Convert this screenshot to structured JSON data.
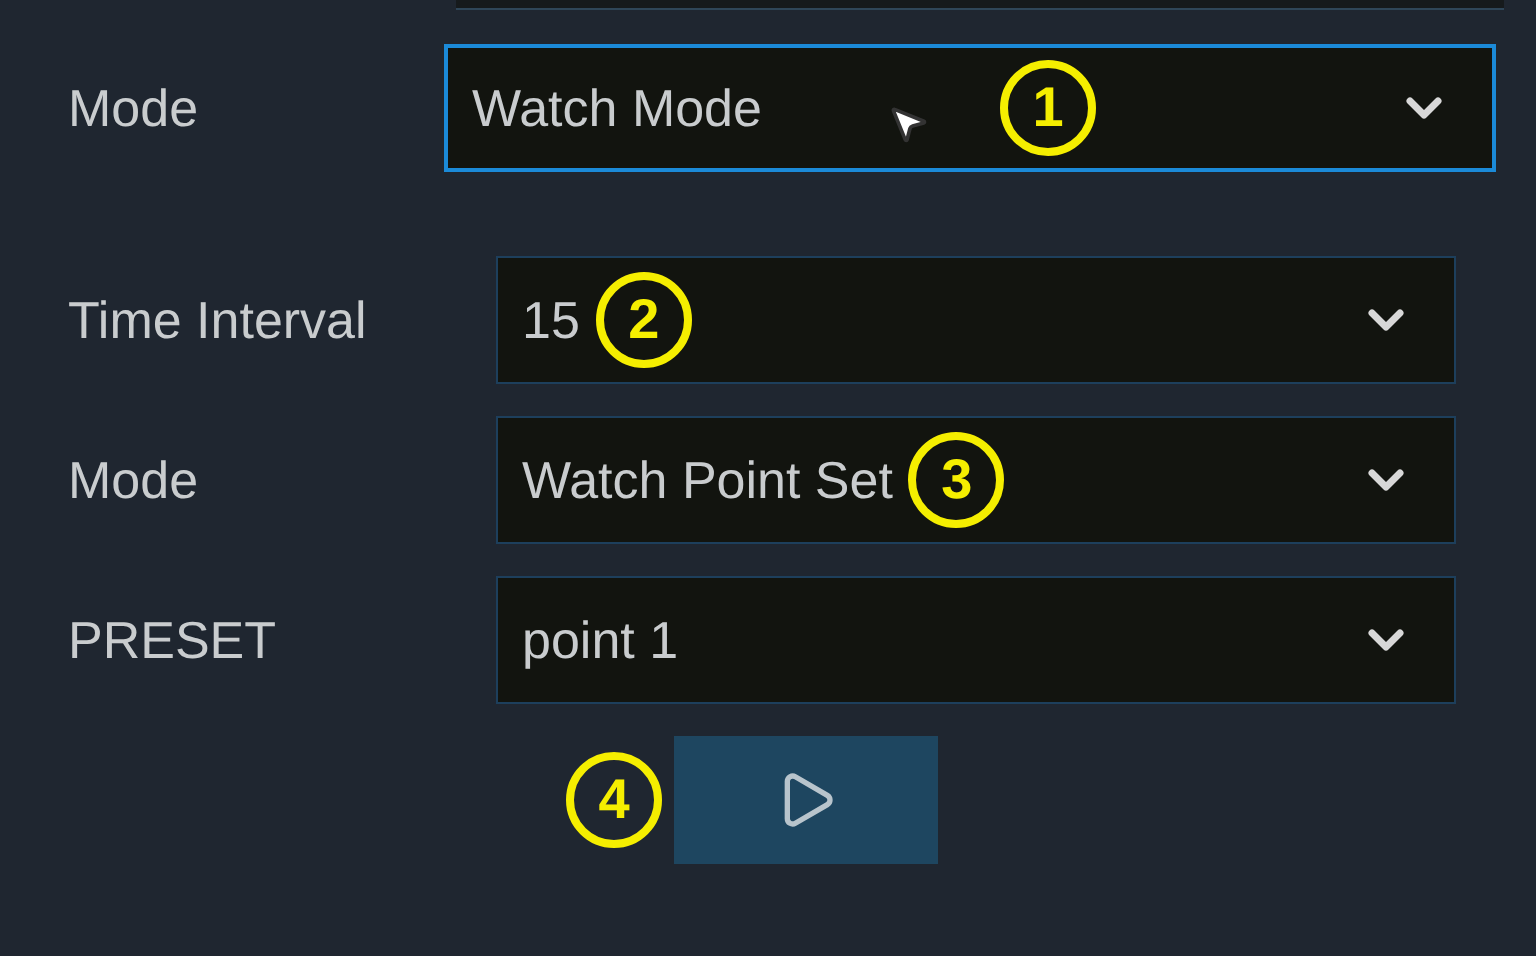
{
  "main_field": {
    "label": "Mode",
    "value": "Watch Mode",
    "focused": true,
    "callout": "1"
  },
  "sub_fields": [
    {
      "label": "Time Interval",
      "value": "15",
      "focused": false,
      "callout": "2"
    },
    {
      "label": "Mode",
      "value": "Watch Point Set",
      "focused": false,
      "callout": "3"
    },
    {
      "label": "PRESET",
      "value": "point 1",
      "focused": false
    }
  ],
  "play_button": {
    "callout": "4"
  }
}
